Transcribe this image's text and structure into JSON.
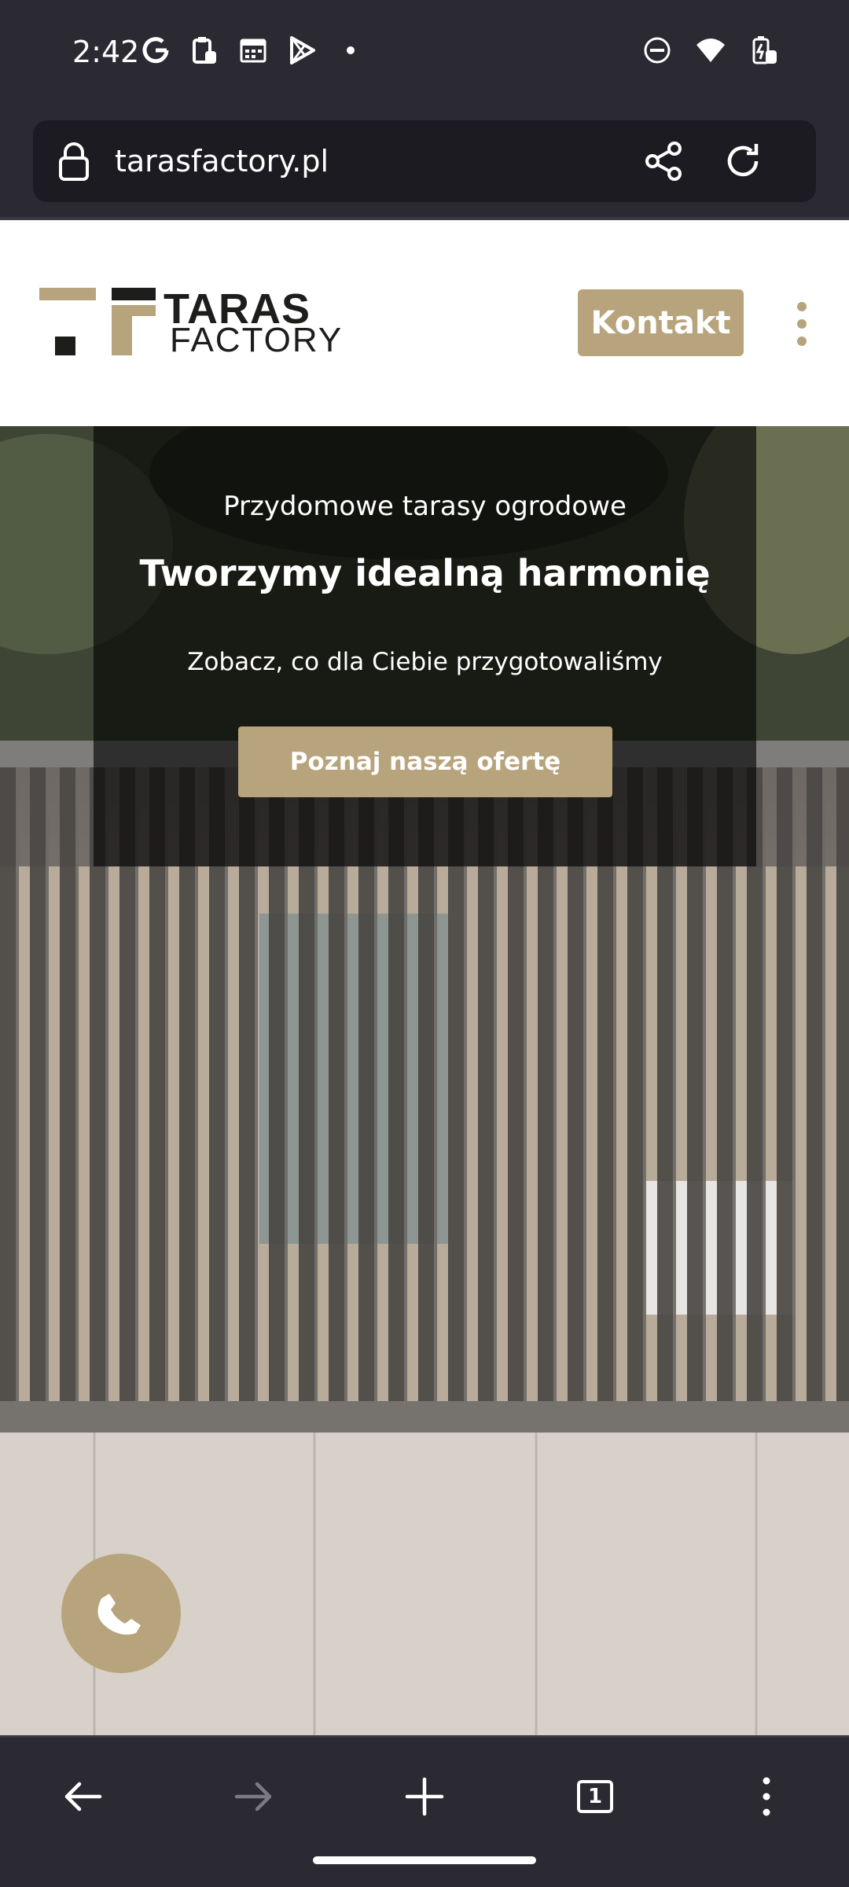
{
  "status_bar": {
    "time": "2:42",
    "left_icons": [
      "google-g-icon",
      "clipboard-icon",
      "calendar-icon",
      "play-store-icon",
      "notification-dot-icon"
    ],
    "right_icons": [
      "dnd-icon",
      "wifi-icon",
      "battery-icon"
    ]
  },
  "browser": {
    "url": "tarasfactory.pl",
    "toolbar": {
      "back": "back-arrow-icon",
      "forward": "forward-arrow-icon",
      "new_tab": "plus-icon",
      "tab_count": "1",
      "menu": "menu-dots-icon"
    }
  },
  "site": {
    "logo": {
      "line1": "TARAS",
      "line2": "FACTORY"
    },
    "contact_label": "Kontakt",
    "hero": {
      "subtitle": "Przydomowe tarasy ogrodowe",
      "title": "Tworzymy idealną harmonię",
      "description": "Zobacz, co dla Ciebie przygotowaliśmy",
      "cta_label": "Poznaj naszą ofertę"
    },
    "phone_icon": "phone-icon"
  },
  "colors": {
    "accent": "#b8a47c",
    "chrome": "#2b2a33",
    "url_bar": "#1c1b22",
    "overlay": "#000000"
  }
}
